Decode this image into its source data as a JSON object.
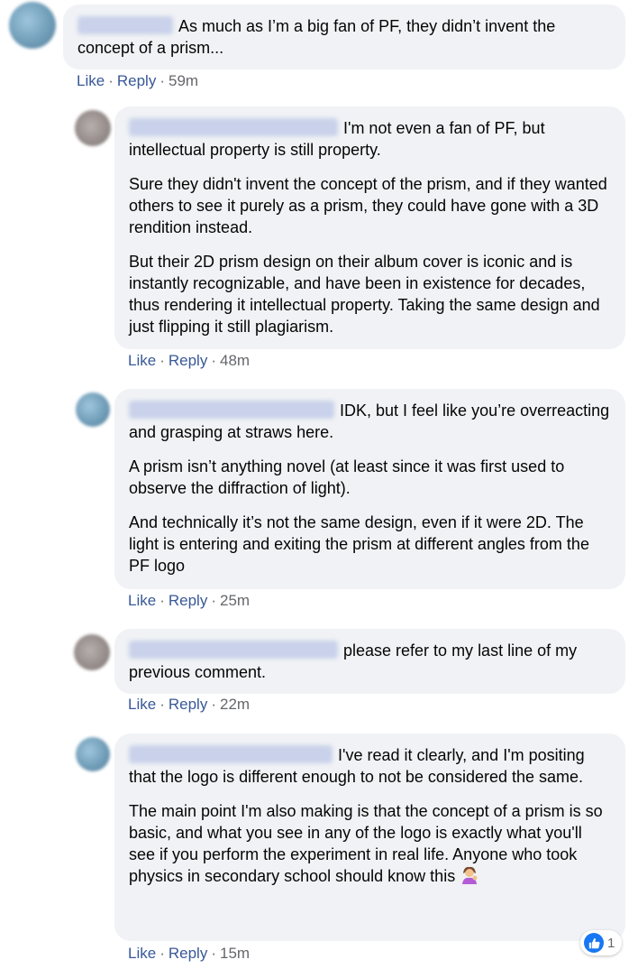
{
  "comments": [
    {
      "id": "c1",
      "avatar_color": "blue",
      "paragraphs": [
        "As much as I’m a big fan of PF, they didn’t invent the concept of a prism..."
      ],
      "actions": {
        "like": "Like",
        "reply": "Reply",
        "time": "59m"
      }
    },
    {
      "id": "c2",
      "avatar_color": "gray",
      "paragraphs": [
        "I'm not even a fan of PF, but intellectual property is still property.",
        "Sure they didn't invent the concept of the prism, and if they wanted others to see it purely as a prism, they could have gone with a 3D rendition instead.",
        "But their 2D prism design on their album cover is iconic and is instantly recognizable, and have been in existence for decades, thus rendering it intellectual property. Taking the same design and just flipping it still plagiarism."
      ],
      "actions": {
        "like": "Like",
        "reply": "Reply",
        "time": "48m"
      }
    },
    {
      "id": "c3",
      "avatar_color": "blue",
      "paragraphs": [
        "IDK, but I feel like you’re overreacting and grasping at straws here.",
        "A prism isn’t anything novel (at least since it was first used to observe the diffraction of light).",
        "And technically it’s not the same design, even if it were 2D. The light is entering and exiting the prism at different angles from the PF logo"
      ],
      "actions": {
        "like": "Like",
        "reply": "Reply",
        "time": "25m"
      }
    },
    {
      "id": "c4",
      "avatar_color": "gray",
      "paragraphs": [
        "please refer to my last line of my previous comment."
      ],
      "actions": {
        "like": "Like",
        "reply": "Reply",
        "time": "22m"
      }
    },
    {
      "id": "c5",
      "avatar_color": "blue",
      "paragraphs": [
        "I've read it clearly, and I'm positing that the logo is different enough to not be considered the same.",
        "The main point I'm also making is that the concept of a prism is so basic, and what you see in any of the logo is exactly what you'll see if you perform the experiment in real life. Anyone who took physics in secondary school should know this"
      ],
      "emoji_icon": "woman-tipping-hand-emoji",
      "actions": {
        "like": "Like",
        "reply": "Reply",
        "time": "15m"
      },
      "reaction": {
        "icon": "like-reaction-icon",
        "count": "1"
      }
    }
  ],
  "colors": {
    "bubble": "#f0f2f5",
    "link": "#385898",
    "meta": "#65676b",
    "like_blue": "#1877f2"
  }
}
